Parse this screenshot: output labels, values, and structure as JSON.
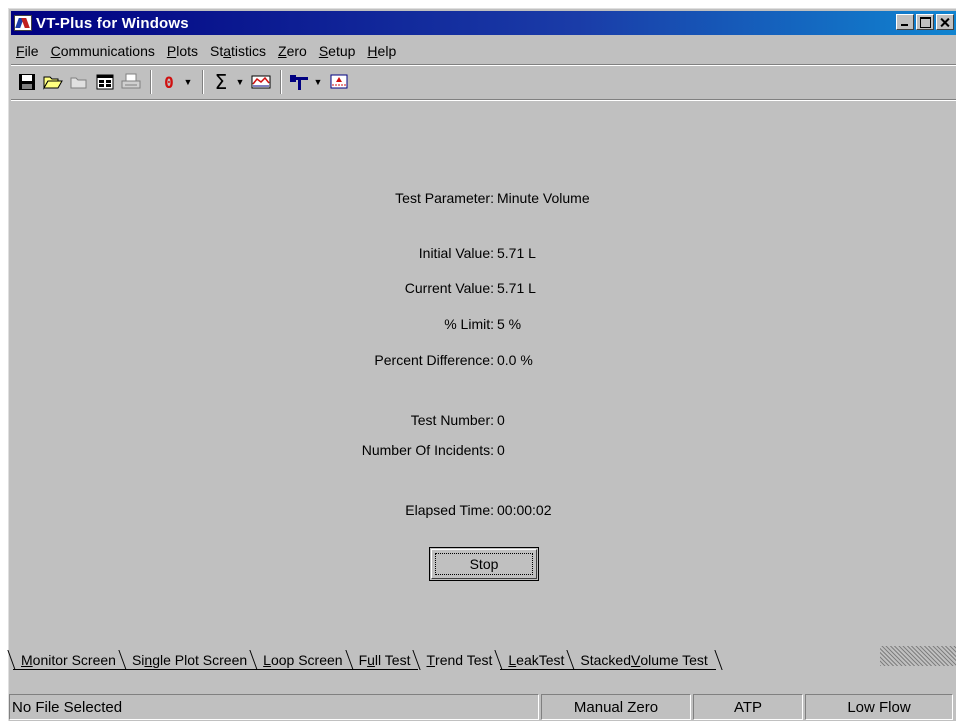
{
  "window": {
    "title": "VT-Plus for Windows"
  },
  "menu": {
    "items": [
      {
        "pre": "",
        "ul": "F",
        "post": "ile"
      },
      {
        "pre": "",
        "ul": "C",
        "post": "ommunications"
      },
      {
        "pre": "",
        "ul": "P",
        "post": "lots"
      },
      {
        "pre": "St",
        "ul": "a",
        "post": "tistics"
      },
      {
        "pre": "",
        "ul": "Z",
        "post": "ero"
      },
      {
        "pre": "",
        "ul": "S",
        "post": "etup"
      },
      {
        "pre": "",
        "ul": "H",
        "post": "elp"
      }
    ]
  },
  "toolbar": {
    "icons": [
      "save-icon",
      "open-folder-icon",
      "folder-icon",
      "form-view-icon",
      "print-icon",
      "zero-icon",
      "sum-icon",
      "chart-icon",
      "valve-icon",
      "trend-chart-icon"
    ],
    "zero_glyph": "0",
    "sum_glyph": "Σ"
  },
  "test": {
    "rows": [
      {
        "label": "Test Parameter:",
        "value": "Minute Volume"
      },
      {
        "label": "Initial Value:",
        "value": "5.71 L"
      },
      {
        "label": "Current Value:",
        "value": "5.71 L"
      },
      {
        "label": "% Limit:",
        "value": "5 %"
      },
      {
        "label": "Percent Difference:",
        "value": "0.0 %"
      },
      {
        "label": "Test Number:",
        "value": "0"
      },
      {
        "label": "Number Of Incidents:",
        "value": "0"
      },
      {
        "label": "Elapsed Time:",
        "value": "00:00:02"
      }
    ],
    "stop_label": "Stop"
  },
  "tabs": [
    {
      "pre": "",
      "ul": "M",
      "post": "onitor Screen",
      "active": false
    },
    {
      "pre": "Si",
      "ul": "n",
      "post": "gle Plot Screen",
      "active": false
    },
    {
      "pre": "",
      "ul": "L",
      "post": "oop Screen",
      "active": false
    },
    {
      "pre": "F",
      "ul": "u",
      "post": "ll Test",
      "active": false
    },
    {
      "pre": "",
      "ul": "T",
      "post": "rend Test",
      "active": true
    },
    {
      "pre": "",
      "ul": "L",
      "post": "eakTest",
      "active": false
    },
    {
      "pre": "Stacked ",
      "ul": "V",
      "post": "olume Test",
      "active": false
    }
  ],
  "status": {
    "file": "No File Selected",
    "zero": "Manual Zero",
    "mode": "ATP",
    "flow": "Low Flow"
  },
  "colors": {
    "titlebar": "#000080",
    "face": "#c0c0c0",
    "zero_red": "#d01010"
  }
}
